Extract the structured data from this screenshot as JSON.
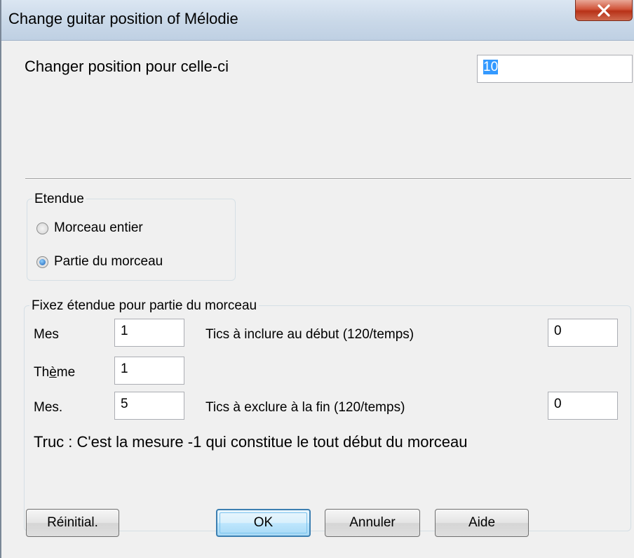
{
  "window": {
    "title": "Change guitar position of Mélodie"
  },
  "position": {
    "label": "Changer position pour celle-ci",
    "value": "10"
  },
  "range_group": {
    "caption": "Etendue",
    "options": [
      {
        "label": "Morceau entier",
        "selected": false
      },
      {
        "label": "Partie du morceau",
        "selected": true
      }
    ]
  },
  "partial_group": {
    "caption": "Fixez étendue pour partie du morceau",
    "mes_label": "Mes",
    "mes_value": "1",
    "theme_label_pre": "Th",
    "theme_label_mnemonic": "è",
    "theme_label_post": "me",
    "theme_value": "1",
    "mes_end_label": "Mes.",
    "mes_end_value": "5",
    "ticks_start_label": "Tics à inclure au début (120/temps)",
    "ticks_start_value": "0",
    "ticks_end_label": "Tics à exclure à la fin (120/temps)",
    "ticks_end_value": "0",
    "tip": "Truc : C'est la mesure -1 qui constitue le tout début du morceau"
  },
  "buttons": {
    "reset": "Réinitial.",
    "ok": "OK",
    "cancel": "Annuler",
    "help": "Aide"
  },
  "colors": {
    "selection": "#3399ff",
    "close_button": "#c8452a",
    "default_button_border": "#3c7fb1"
  }
}
